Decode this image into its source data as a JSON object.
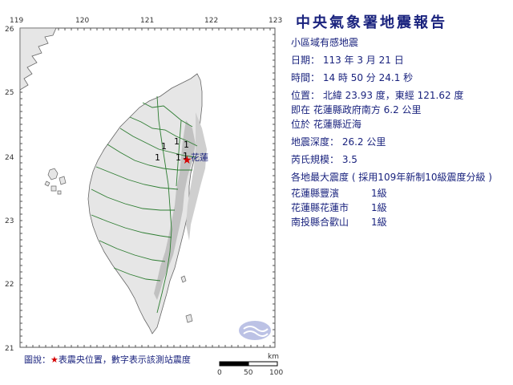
{
  "report": {
    "title": "中央氣象署地震報告",
    "subtitle": "小區域有感地震",
    "date_line": "日期： 113 年 3 月 21 日",
    "time_line": "時間： 14 時 50 分 24.1 秒",
    "position_line": "位置： 北緯 23.93 度，東經 121.62 度",
    "relative_line": "即在 花蓮縣政府南方 6.2 公里",
    "region_line": "位於 花蓮縣近海",
    "depth_line": "地震深度： 26.2 公里",
    "magnitude_line": "芮氏規模： 3.5",
    "intensity_header": "各地最大震度 ( 採用109年新制10級震度分級 )"
  },
  "stations": [
    {
      "name": "花蓮縣豐濱",
      "intensity": "1級"
    },
    {
      "name": "花蓮縣花蓮市",
      "intensity": "1級"
    },
    {
      "name": "南投縣合歡山",
      "intensity": "1級"
    }
  ],
  "map": {
    "lon_labels": [
      "119",
      "120",
      "121",
      "122",
      "123"
    ],
    "lat_labels": [
      "26",
      "25",
      "24",
      "23",
      "22",
      "21"
    ],
    "city_label": "花蓮",
    "station_marks": [
      "1",
      "1",
      "1",
      "1",
      "1",
      "1"
    ],
    "epicenter_color": "#d50000",
    "land_color": "#e6e6e6",
    "mountain_color": "#bdbdbd",
    "county_line_color": "#2e7d32",
    "label_color": "#1a237e",
    "legend": {
      "prefix": "圖說：",
      "star": "★",
      "text": "表震央位置，數字表示該測站震度"
    },
    "scale": {
      "unit": "km",
      "ticks": [
        "0",
        "50",
        "100"
      ]
    }
  }
}
